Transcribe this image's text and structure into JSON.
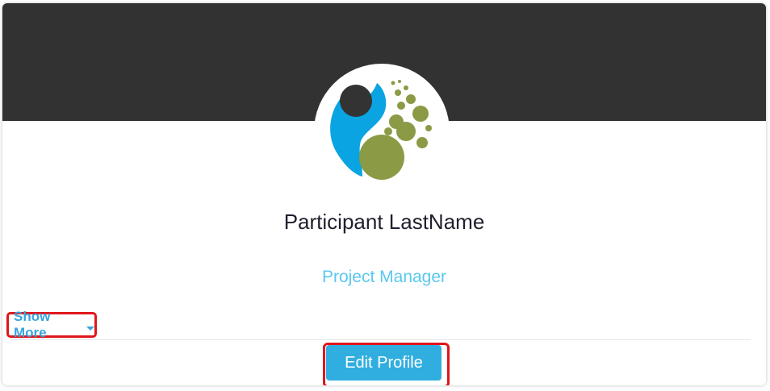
{
  "profile": {
    "name": "Participant LastName",
    "role": "Project Manager"
  },
  "actions": {
    "show_more_label": "Show More",
    "edit_profile_label": "Edit Profile"
  },
  "colors": {
    "banner": "#323232",
    "accent": "#31aee0",
    "role_text": "#5ac8f0",
    "highlight": "#e0161b",
    "logo_blue": "#0aa4e2",
    "logo_olive": "#8b9a45",
    "logo_dark": "#333333"
  },
  "icons": {
    "avatar": "organization-logo-icon",
    "show_more_caret": "caret-down-icon"
  }
}
